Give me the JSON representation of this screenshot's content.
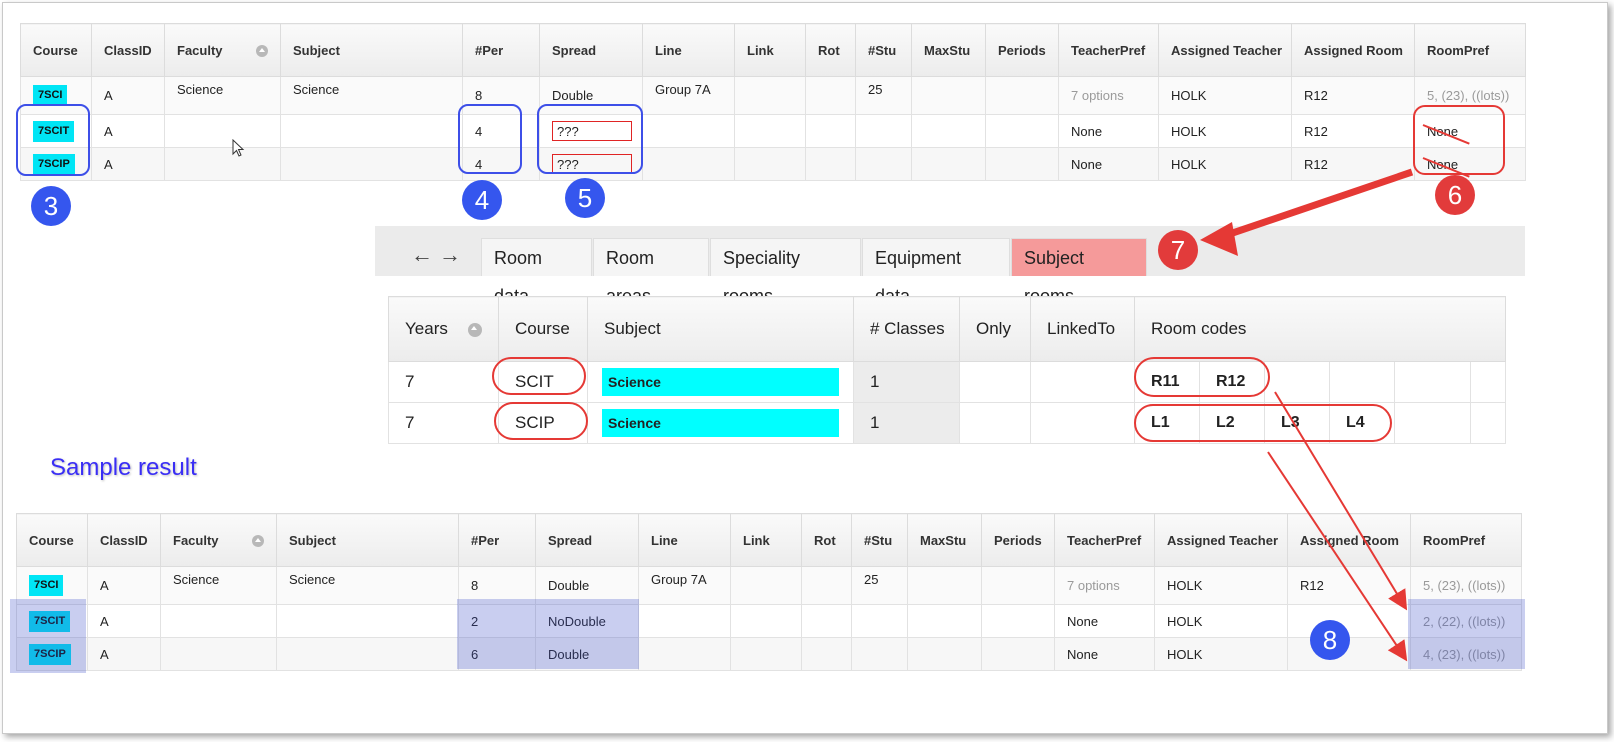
{
  "grid_columns": [
    "Course",
    "ClassID",
    "Faculty",
    "Subject",
    "#Per",
    "Spread",
    "Line",
    "Link",
    "Rot",
    "#Stu",
    "MaxStu",
    "Periods",
    "TeacherPref",
    "Assigned Teacher",
    "Assigned Room",
    "RoomPref"
  ],
  "top_grid": {
    "rows": [
      {
        "course": "7SCI",
        "classid": "A",
        "faculty": "Science",
        "subject": "Science",
        "per": "8",
        "spread": "Double",
        "line": "Group 7A",
        "link": "",
        "rot": "",
        "stu": "25",
        "maxstu": "",
        "periods": "",
        "teacherpref": "7 options",
        "teacher": "HOLK",
        "room": "R12",
        "roompref": "5, (23), ((lots))"
      },
      {
        "course": "7SCIT",
        "classid": "A",
        "faculty": "",
        "subject": "",
        "per": "4",
        "spread": "???",
        "line": "",
        "link": "",
        "rot": "",
        "stu": "",
        "maxstu": "",
        "periods": "",
        "teacherpref": "None",
        "teacher": "HOLK",
        "room": "R12",
        "roompref": "None"
      },
      {
        "course": "7SCIP",
        "classid": "A",
        "faculty": "",
        "subject": "",
        "per": "4",
        "spread": "???",
        "line": "",
        "link": "",
        "rot": "",
        "stu": "",
        "maxstu": "",
        "periods": "",
        "teacherpref": "None",
        "teacher": "HOLK",
        "room": "R12",
        "roompref": "None"
      }
    ]
  },
  "tabs": [
    "Room data",
    "Room areas",
    "Speciality rooms",
    "Equipment data",
    "Subject rooms"
  ],
  "active_tab": "Subject rooms",
  "subject_rooms": {
    "headers": [
      "Years",
      "Course",
      "Subject",
      "# Classes",
      "Only",
      "LinkedTo",
      "Room codes"
    ],
    "rows": [
      {
        "years": "7",
        "course": "SCIT",
        "subject": "Science",
        "classes": "1",
        "rooms": [
          "R11",
          "R12",
          "",
          "",
          "",
          ""
        ]
      },
      {
        "years": "7",
        "course": "SCIP",
        "subject": "Science",
        "classes": "1",
        "rooms": [
          "L1",
          "L2",
          "L3",
          "L4",
          "",
          ""
        ]
      }
    ]
  },
  "sample_label": "Sample result",
  "bottom_grid": {
    "rows": [
      {
        "course": "7SCI",
        "classid": "A",
        "faculty": "Science",
        "subject": "Science",
        "per": "8",
        "spread": "Double",
        "line": "Group 7A",
        "stu": "25",
        "teacherpref": "7 options",
        "teacher": "HOLK",
        "room": "R12",
        "roompref": "5, (23), ((lots))"
      },
      {
        "course": "7SCIT",
        "classid": "A",
        "faculty": "",
        "subject": "",
        "per": "2",
        "spread": "NoDouble",
        "line": "",
        "stu": "",
        "teacherpref": "None",
        "teacher": "HOLK",
        "room": "",
        "roompref": "2, (22), ((lots))"
      },
      {
        "course": "7SCIP",
        "classid": "A",
        "faculty": "",
        "subject": "",
        "per": "6",
        "spread": "Double",
        "line": "",
        "stu": "",
        "teacherpref": "None",
        "teacher": "HOLK",
        "room": "",
        "roompref": "4, (23), ((lots))"
      }
    ]
  },
  "callouts": [
    "3",
    "4",
    "5",
    "6",
    "7",
    "8"
  ],
  "colors": {
    "chip": "#00e5f5",
    "callout_blue": "#3556ee",
    "callout_red": "#e23b3b",
    "active_tab": "#f59a9a",
    "highlight": "#3c50c8"
  }
}
